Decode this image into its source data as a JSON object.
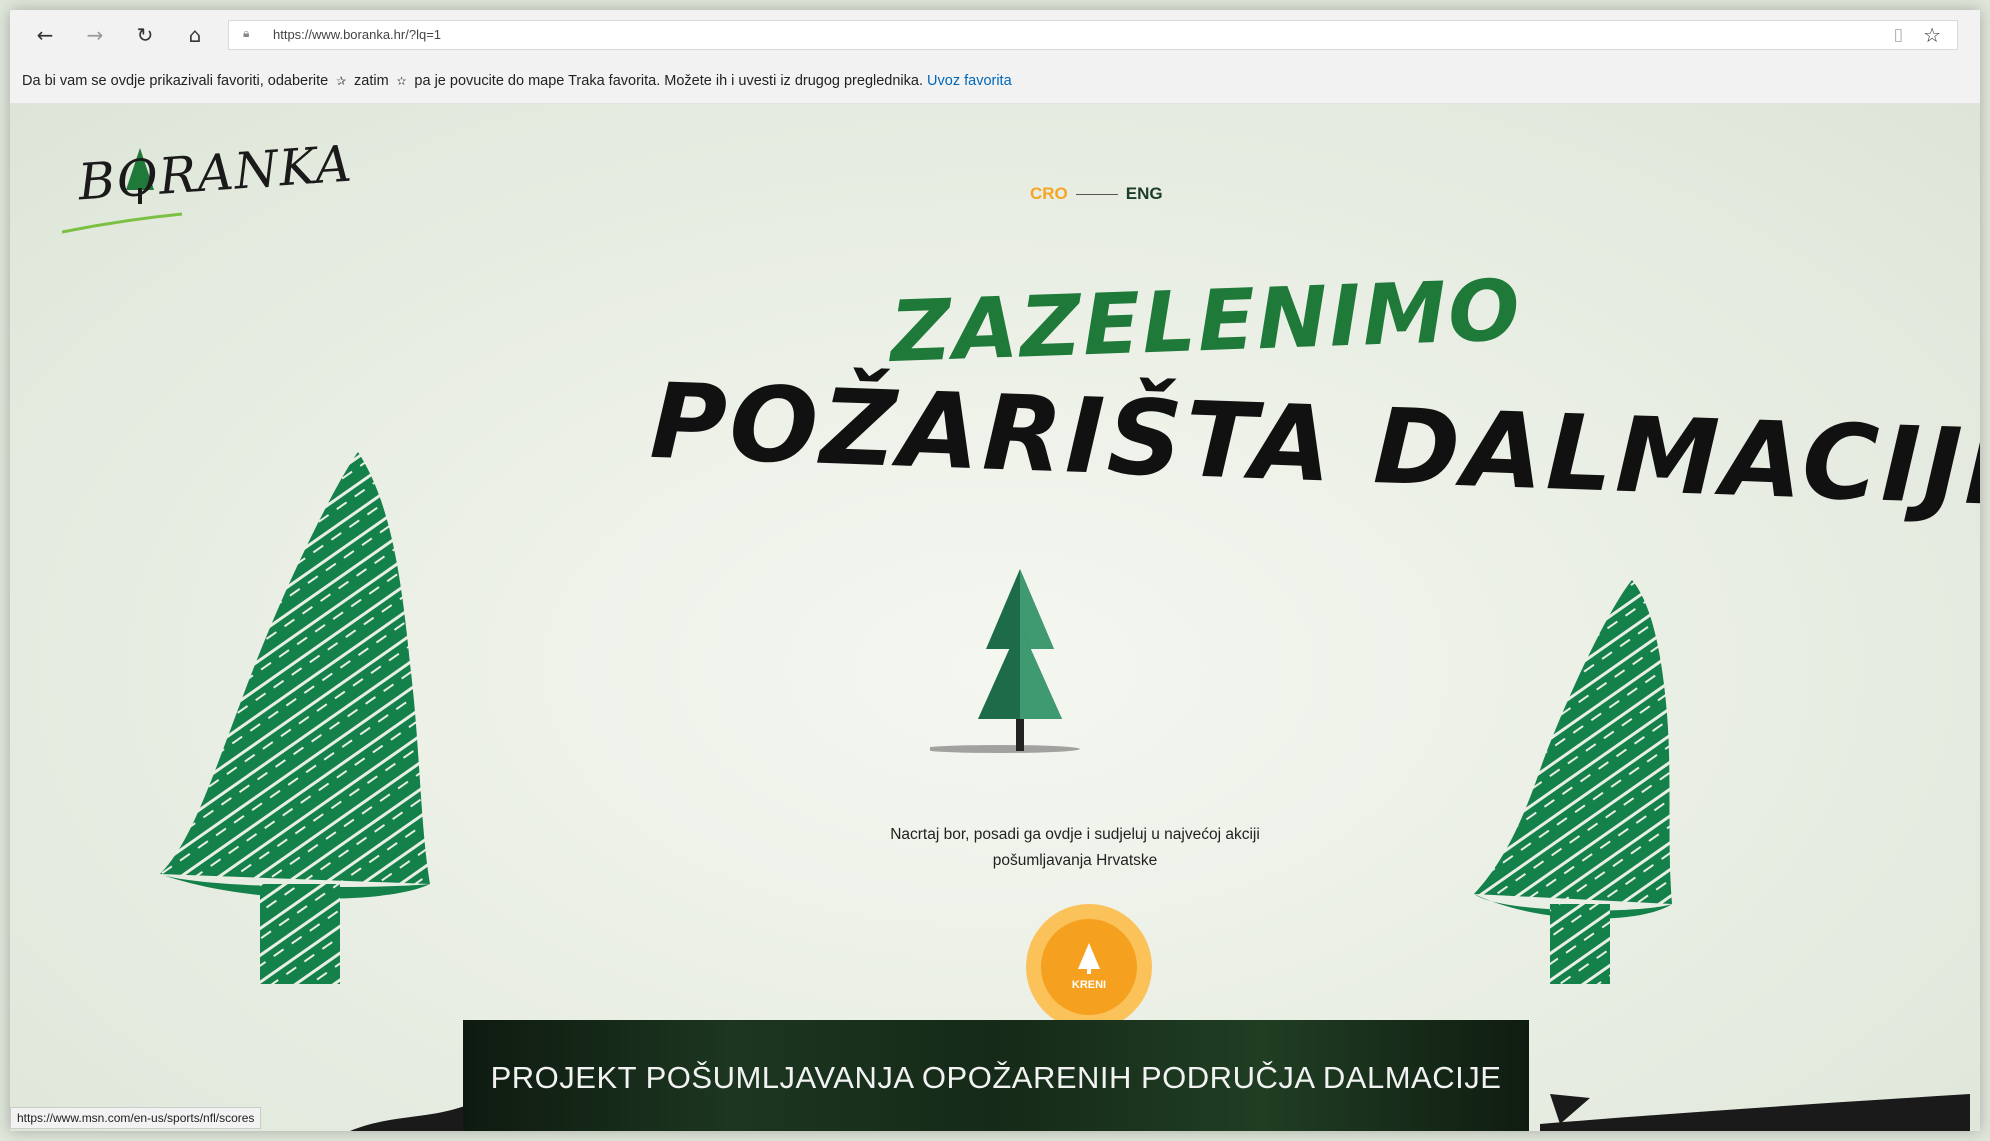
{
  "browser": {
    "url": "https://www.boranka.hr/?lq=1",
    "nav_icons": [
      "back-arrow-icon",
      "forward-arrow-icon",
      "refresh-icon",
      "home-icon"
    ],
    "favorites_message": "Da bi vam se ovdje prikazivali favoriti, odaberite",
    "favorites_mid": "zatim",
    "favorites_tail": "pa je povucite do mape Traka favorita. Možete ih i uvesti iz drugog preglednika.",
    "import_link": "Uvoz favorita",
    "status_url": "https://www.msn.com/en-us/sports/nfl/scores"
  },
  "page": {
    "logo": "BORANKA",
    "lang_cro": "CRO",
    "lang_eng": "ENG",
    "headline_1": "ZAZELENIMO",
    "headline_2": "POŽARIŠTA DALMACIJE",
    "tagline_line1": "Nacrtaj bor, posadi ga ovdje i sudjeluj u najvećoj akciji",
    "tagline_line2": "pošumljavanja Hrvatske",
    "go_label": "KRENI",
    "banner": "PROJEKT POŠUMLJAVANJA OPOŽARENIH PODRUČJA DALMACIJE"
  },
  "colors": {
    "accent_orange": "#f5a01e",
    "headline_green": "#1f7a3a",
    "tree_green": "#14804a"
  }
}
